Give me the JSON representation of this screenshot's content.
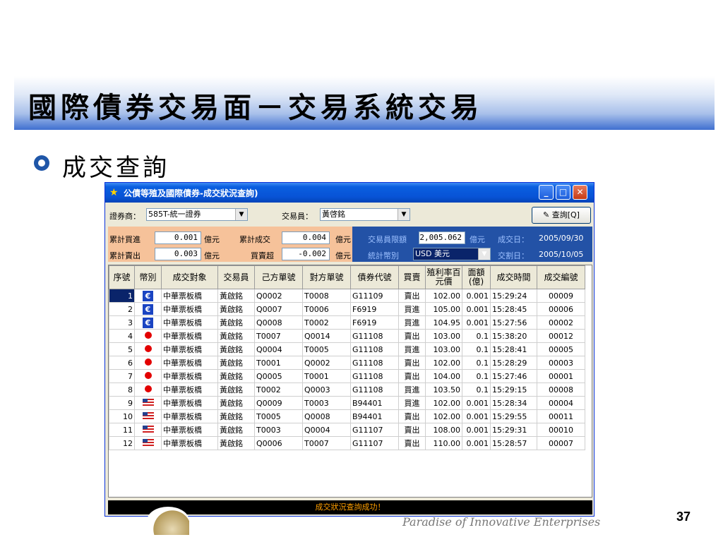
{
  "slide": {
    "title": "國際債券交易面－交易系統交易",
    "bullet": "成交查詢",
    "page_number": "37",
    "footer_text": "Paradise of Innovative Enterprises"
  },
  "window": {
    "title": "公債等殖及國際債券-成交狀況查詢)",
    "broker_label": "證券商：",
    "broker_value": "585T-統一證券",
    "trader_label": "交易員：",
    "trader_value": "黃啓銘",
    "query_button": "查詢[Q]",
    "stats": {
      "cum_buy_label": "累計買進",
      "cum_buy_value": "0.001",
      "cum_sell_label": "累計賣出",
      "cum_sell_value": "0.003",
      "unit": "億元",
      "cum_deal_label": "累計成交",
      "cum_deal_value": "0.004",
      "net_label": "買賣超",
      "net_value": "-0.002",
      "limit_label": "交易員限額",
      "limit_value": "2,005.062",
      "currency_label": "統計幣別",
      "currency_value": "USD 美元",
      "deal_date_label": "成交日：",
      "deal_date_value": "2005/09/30",
      "settle_date_label": "交割日：",
      "settle_date_value": "2005/10/05"
    },
    "columns": [
      "序號",
      "幣別",
      "成交對象",
      "交易員",
      "己方單號",
      "對方單號",
      "債券代號",
      "買賣",
      "殖利率百元價",
      "面額(億)",
      "成交時間",
      "成交編號"
    ],
    "rows": [
      {
        "no": "1",
        "cur": "euro",
        "counterparty": "中華票板橋",
        "trader": "黃啟銘",
        "own": "Q0002",
        "other": "T0008",
        "bond": "G11109",
        "side": "賣出",
        "price": "102.00",
        "face": "0.001",
        "time": "15:29:24",
        "deal": "00009"
      },
      {
        "no": "2",
        "cur": "euro",
        "counterparty": "中華票板橋",
        "trader": "黃啟銘",
        "own": "Q0007",
        "other": "T0006",
        "bond": "F6919",
        "side": "買進",
        "price": "105.00",
        "face": "0.001",
        "time": "15:28:45",
        "deal": "00006"
      },
      {
        "no": "3",
        "cur": "euro",
        "counterparty": "中華票板橋",
        "trader": "黃啟銘",
        "own": "Q0008",
        "other": "T0002",
        "bond": "F6919",
        "side": "買進",
        "price": "104.95",
        "face": "0.001",
        "time": "15:27:56",
        "deal": "00002"
      },
      {
        "no": "4",
        "cur": "jpy",
        "counterparty": "中華票板橋",
        "trader": "黃啟銘",
        "own": "T0007",
        "other": "Q0014",
        "bond": "G11108",
        "side": "賣出",
        "price": "103.00",
        "face": "0.1",
        "time": "15:38:20",
        "deal": "00012"
      },
      {
        "no": "5",
        "cur": "jpy",
        "counterparty": "中華票板橋",
        "trader": "黃啟銘",
        "own": "Q0004",
        "other": "T0005",
        "bond": "G11108",
        "side": "買進",
        "price": "103.00",
        "face": "0.1",
        "time": "15:28:41",
        "deal": "00005"
      },
      {
        "no": "6",
        "cur": "jpy",
        "counterparty": "中華票板橋",
        "trader": "黃啟銘",
        "own": "T0001",
        "other": "Q0002",
        "bond": "G11108",
        "side": "賣出",
        "price": "102.00",
        "face": "0.1",
        "time": "15:28:29",
        "deal": "00003"
      },
      {
        "no": "7",
        "cur": "jpy",
        "counterparty": "中華票板橋",
        "trader": "黃啟銘",
        "own": "Q0005",
        "other": "T0001",
        "bond": "G11108",
        "side": "賣出",
        "price": "104.00",
        "face": "0.1",
        "time": "15:27:46",
        "deal": "00001"
      },
      {
        "no": "8",
        "cur": "jpy",
        "counterparty": "中華票板橋",
        "trader": "黃啟銘",
        "own": "T0002",
        "other": "Q0003",
        "bond": "G11108",
        "side": "買進",
        "price": "103.50",
        "face": "0.1",
        "time": "15:29:15",
        "deal": "00008"
      },
      {
        "no": "9",
        "cur": "usd",
        "counterparty": "中華票板橋",
        "trader": "黃啟銘",
        "own": "Q0009",
        "other": "T0003",
        "bond": "B94401",
        "side": "買進",
        "price": "102.00",
        "face": "0.001",
        "time": "15:28:34",
        "deal": "00004"
      },
      {
        "no": "10",
        "cur": "usd",
        "counterparty": "中華票板橋",
        "trader": "黃啟銘",
        "own": "T0005",
        "other": "Q0008",
        "bond": "B94401",
        "side": "賣出",
        "price": "102.00",
        "face": "0.001",
        "time": "15:29:55",
        "deal": "00011"
      },
      {
        "no": "11",
        "cur": "usd",
        "counterparty": "中華票板橋",
        "trader": "黃啟銘",
        "own": "T0003",
        "other": "Q0004",
        "bond": "G11107",
        "side": "賣出",
        "price": "108.00",
        "face": "0.001",
        "time": "15:29:31",
        "deal": "00010"
      },
      {
        "no": "12",
        "cur": "usd",
        "counterparty": "中華票板橋",
        "trader": "黃啟銘",
        "own": "Q0006",
        "other": "T0007",
        "bond": "G11107",
        "side": "賣出",
        "price": "110.00",
        "face": "0.001",
        "time": "15:28:57",
        "deal": "00007"
      }
    ],
    "status_text": "成交狀況查詢成功！"
  },
  "colors": {
    "accent": "#0853d6",
    "stats_left": "#f6c29a",
    "stats_right": "#2352a6",
    "status_text": "#ff9f00"
  }
}
